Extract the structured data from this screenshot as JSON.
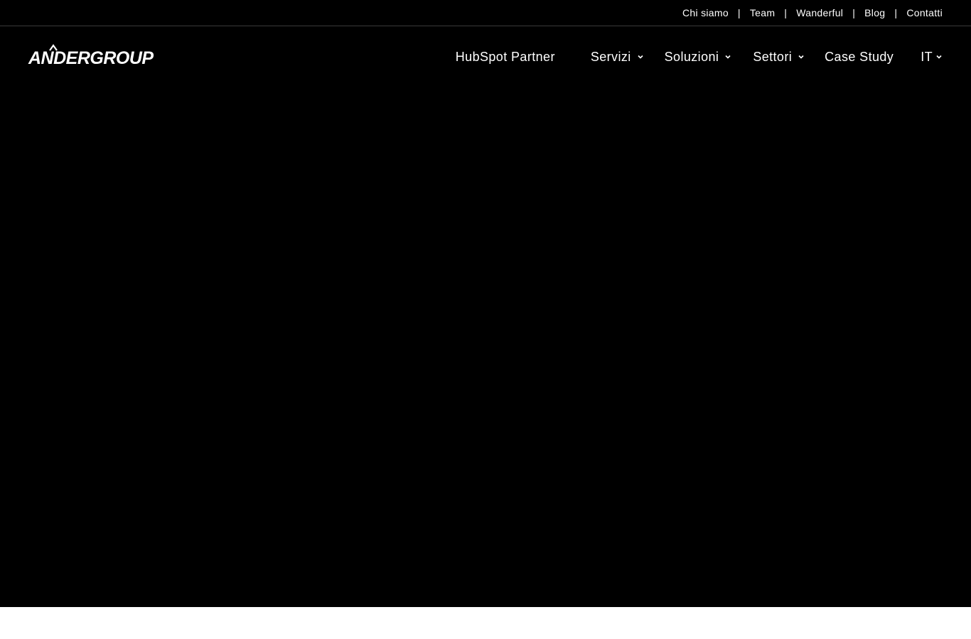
{
  "topbar": {
    "links": [
      {
        "label": "Chi siamo"
      },
      {
        "label": "Team"
      },
      {
        "label": "Wanderful"
      },
      {
        "label": "Blog"
      },
      {
        "label": "Contatti"
      }
    ],
    "separator": "|"
  },
  "logo": {
    "text": "ANDERGROUP"
  },
  "nav": {
    "hubspot": "HubSpot Partner",
    "servizi": "Servizi",
    "soluzioni": "Soluzioni",
    "settori": "Settori",
    "case_study": "Case Study",
    "language": "IT"
  },
  "colors": {
    "hero_background": "#000000",
    "text": "#ffffff",
    "page_background": "#ffffff"
  },
  "icons": {
    "dropdown": "chevron-down-icon"
  }
}
